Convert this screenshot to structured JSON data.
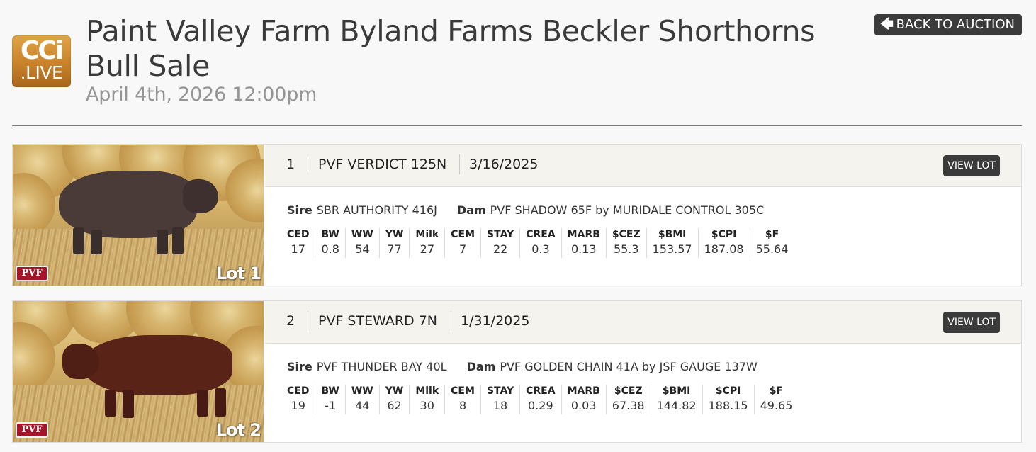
{
  "logo": {
    "top": "CCi",
    "bottom": ".LIVE"
  },
  "header": {
    "title": "Paint Valley Farm Byland Farms Beckler Shorthorns Bull Sale",
    "date": "April 4th, 2026 12:00pm",
    "back_label": "BACK TO AUCTION"
  },
  "lots": [
    {
      "number": "1",
      "name": "PVF VERDICT 125N",
      "birthdate": "3/16/2025",
      "view_label": "VIEW LOT",
      "photo_tag": "Lot 1",
      "brand": "PVF",
      "sire_label": "Sire",
      "sire": "SBR AUTHORITY 416J",
      "dam_label": "Dam",
      "dam": "PVF SHADOW 65F by MURIDALE CONTROL 305C",
      "epds": [
        {
          "h": "CED",
          "v": "17"
        },
        {
          "h": "BW",
          "v": "0.8"
        },
        {
          "h": "WW",
          "v": "54"
        },
        {
          "h": "YW",
          "v": "77"
        },
        {
          "h": "Milk",
          "v": "27"
        },
        {
          "h": "CEM",
          "v": "7"
        },
        {
          "h": "STAY",
          "v": "22"
        },
        {
          "h": "CREA",
          "v": "0.3"
        },
        {
          "h": "MARB",
          "v": "0.13"
        },
        {
          "h": "$CEZ",
          "v": "55.3"
        },
        {
          "h": "$BMI",
          "v": "153.57"
        },
        {
          "h": "$CPI",
          "v": "187.08"
        },
        {
          "h": "$F",
          "v": "55.64"
        }
      ]
    },
    {
      "number": "2",
      "name": "PVF STEWARD 7N",
      "birthdate": "1/31/2025",
      "view_label": "VIEW LOT",
      "photo_tag": "Lot 2",
      "brand": "PVF",
      "sire_label": "Sire",
      "sire": "PVF THUNDER BAY 40L",
      "dam_label": "Dam",
      "dam": "PVF GOLDEN CHAIN 41A by JSF GAUGE 137W",
      "epds": [
        {
          "h": "CED",
          "v": "19"
        },
        {
          "h": "BW",
          "v": "-1"
        },
        {
          "h": "WW",
          "v": "44"
        },
        {
          "h": "YW",
          "v": "62"
        },
        {
          "h": "Milk",
          "v": "30"
        },
        {
          "h": "CEM",
          "v": "8"
        },
        {
          "h": "STAY",
          "v": "18"
        },
        {
          "h": "CREA",
          "v": "0.29"
        },
        {
          "h": "MARB",
          "v": "0.03"
        },
        {
          "h": "$CEZ",
          "v": "67.38"
        },
        {
          "h": "$BMI",
          "v": "144.82"
        },
        {
          "h": "$CPI",
          "v": "188.15"
        },
        {
          "h": "$F",
          "v": "49.65"
        }
      ]
    }
  ]
}
